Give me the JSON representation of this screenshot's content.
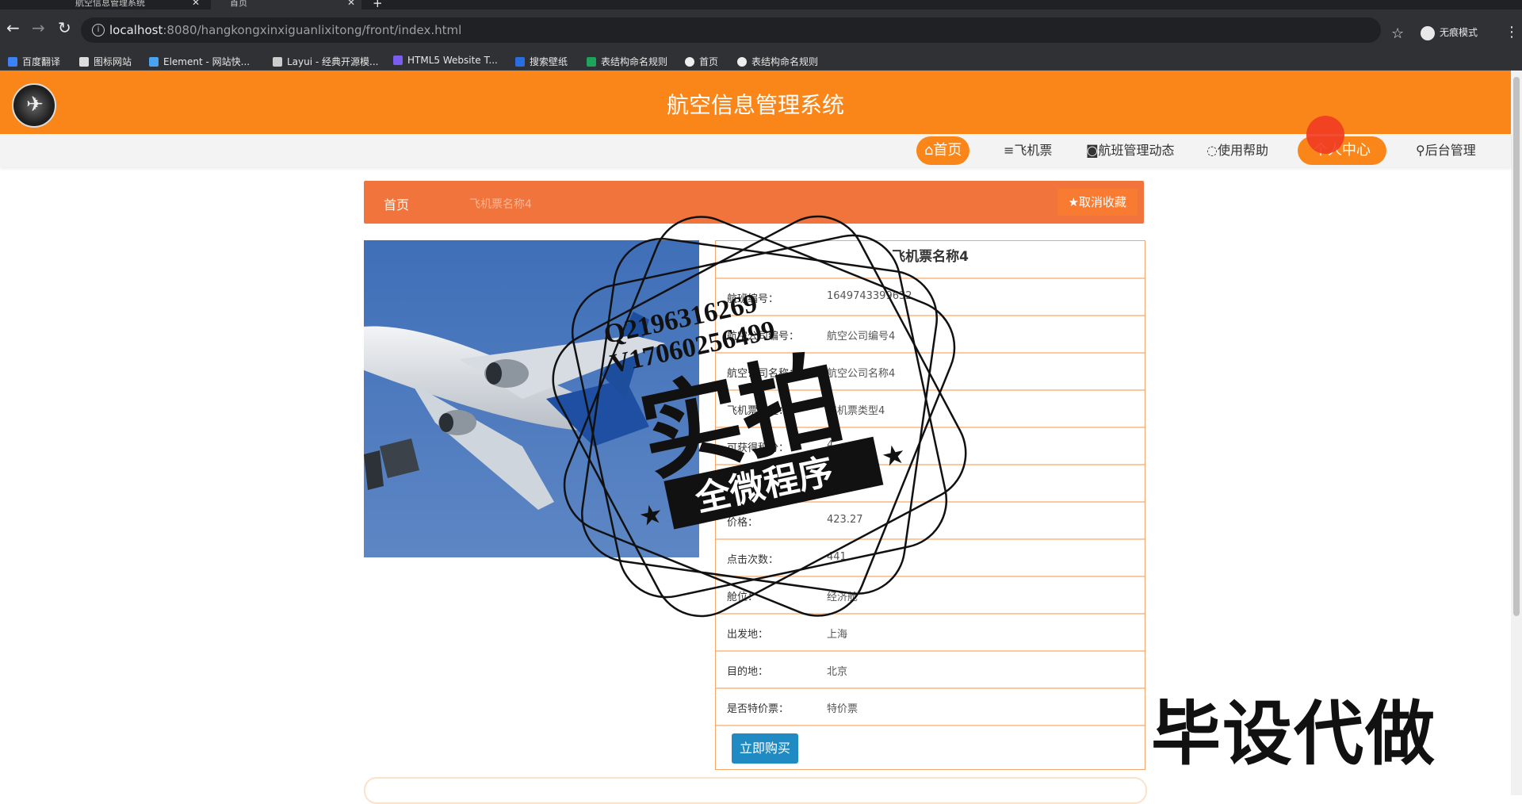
{
  "browser": {
    "tabs": [
      {
        "label": "航空信息管理系统",
        "active": false
      },
      {
        "label": "首页",
        "active": true
      }
    ],
    "new_tab": "+",
    "url_host": "localhost",
    "url_rest": ":8080/hangkongxinxiguanlixitong/front/index.html",
    "incognito_label": "无痕模式",
    "bookmarks": [
      "百度翻译",
      "图标网站",
      "Element - 网站快...",
      "Layui - 经典开源模...",
      "HTML5 Website T...",
      "搜索壁纸",
      "表结构命名规则",
      "首页",
      "表结构命名规则"
    ]
  },
  "site": {
    "title": "航空信息管理系统",
    "nav": [
      {
        "label": "⌂首页",
        "highlight": true
      },
      {
        "label": "≡飞机票",
        "highlight": false
      },
      {
        "label": "◙航班管理动态",
        "highlight": false
      },
      {
        "label": "◌使用帮助",
        "highlight": false
      },
      {
        "label": "个人中心",
        "highlight": true
      },
      {
        "label": "⚲后台管理",
        "highlight": false
      }
    ]
  },
  "breadcrumb": {
    "home": "首页",
    "current": "飞机票名称4",
    "fav_button": "★取消收藏"
  },
  "detail": {
    "title": "飞机票名称4",
    "rows": [
      {
        "label": "航班编号：",
        "value": "1649743399632"
      },
      {
        "label": "航空公司编号：",
        "value": "航空公司编号4"
      },
      {
        "label": "航空公司名称：",
        "value": "航空公司名称4"
      },
      {
        "label": "飞机票类型：",
        "value": "飞机票类型4"
      },
      {
        "label": "可获得积分：",
        "value": "4"
      },
      {
        "label": "飞机票日期：",
        "value": ""
      },
      {
        "label": "价格：",
        "value": "423.27"
      },
      {
        "label": "点击次数：",
        "value": "441"
      },
      {
        "label": "舱位：",
        "value": "经济舱"
      },
      {
        "label": "出发地：",
        "value": "上海"
      },
      {
        "label": "目的地：",
        "value": "北京"
      },
      {
        "label": "是否特价票：",
        "value": "特价票"
      }
    ],
    "buy_button": "立即购买"
  },
  "watermark": {
    "line1": "Q2196316269",
    "line2": "V17060256499",
    "big": "实拍",
    "ribbon": "全微程序",
    "corner": "毕设代做"
  },
  "colors": {
    "header": "#fa861a",
    "crumb": "#f0743c",
    "buy": "#1f8bc2"
  }
}
